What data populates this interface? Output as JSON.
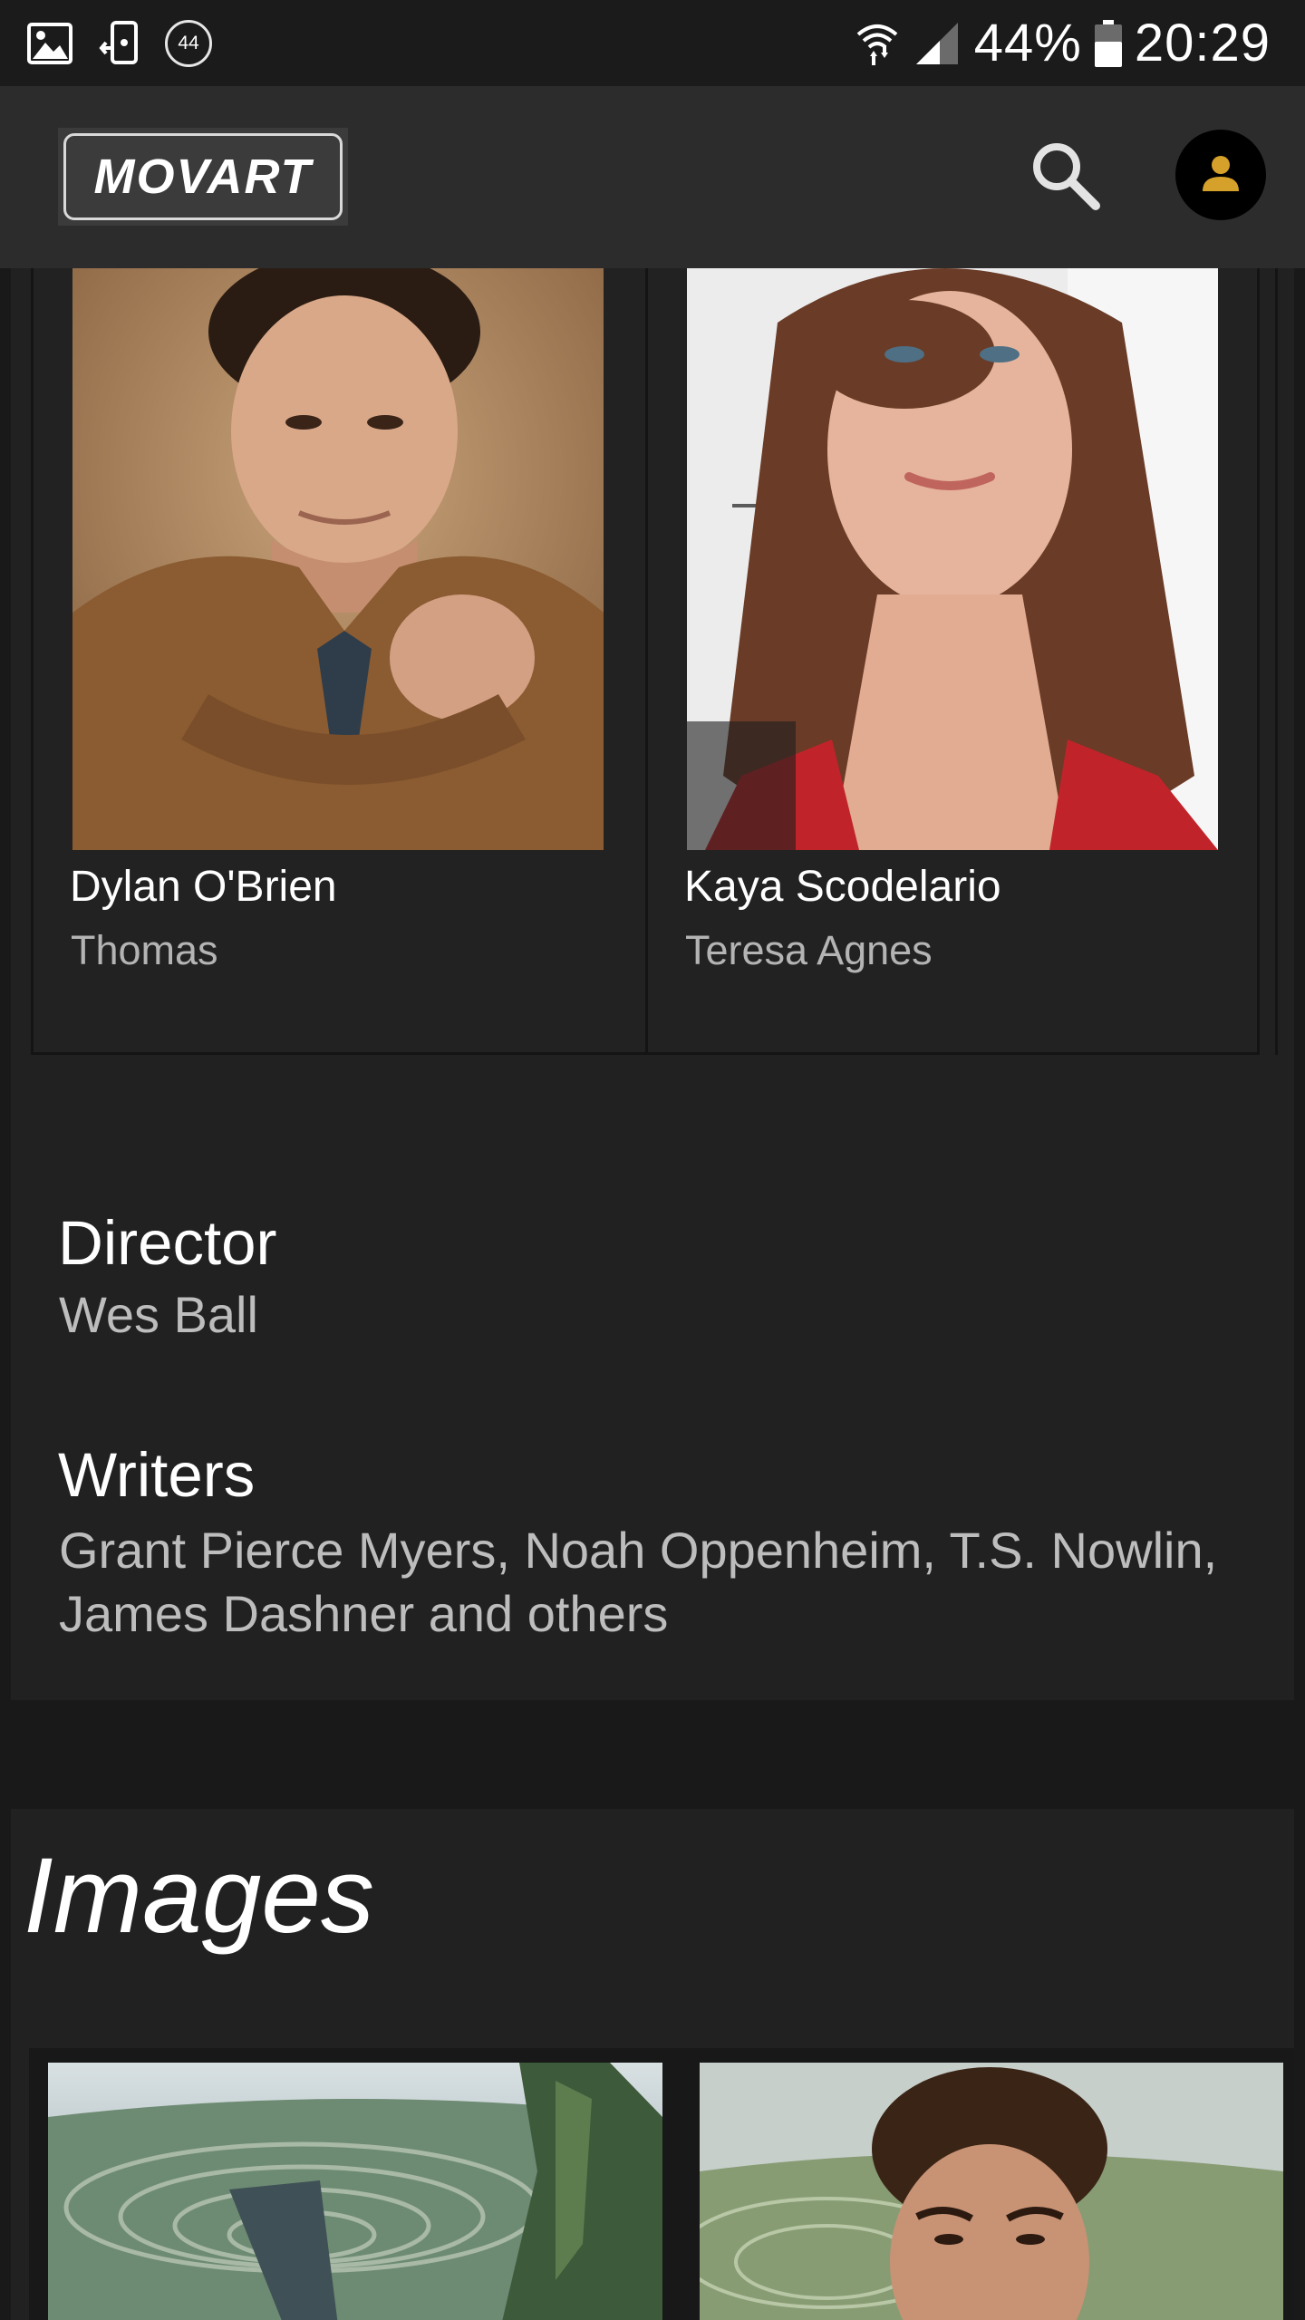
{
  "status_bar": {
    "icons_left": [
      "gallery-icon",
      "phone-sync-icon",
      "notification-count-icon"
    ],
    "notification_count": "44",
    "icons_right": [
      "wifi-icon",
      "signal-icon",
      "battery-icon"
    ],
    "battery": "44%",
    "time": "20:29"
  },
  "header": {
    "logo": "MOVART",
    "search_icon": "search-icon",
    "account_icon": "person-icon",
    "accent_color": "#d6a12a"
  },
  "cast": [
    {
      "name": "Dylan O'Brien",
      "role": "Thomas"
    },
    {
      "name": "Kaya Scodelario",
      "role": "Teresa Agnes"
    }
  ],
  "credits": {
    "director_label": "Director",
    "director": "Wes Ball",
    "writers_label": "Writers",
    "writers": "Grant Pierce Myers, Noah Oppenheim, T.S. Nowlin, James Dashner and others"
  },
  "images": {
    "title": "Images"
  }
}
